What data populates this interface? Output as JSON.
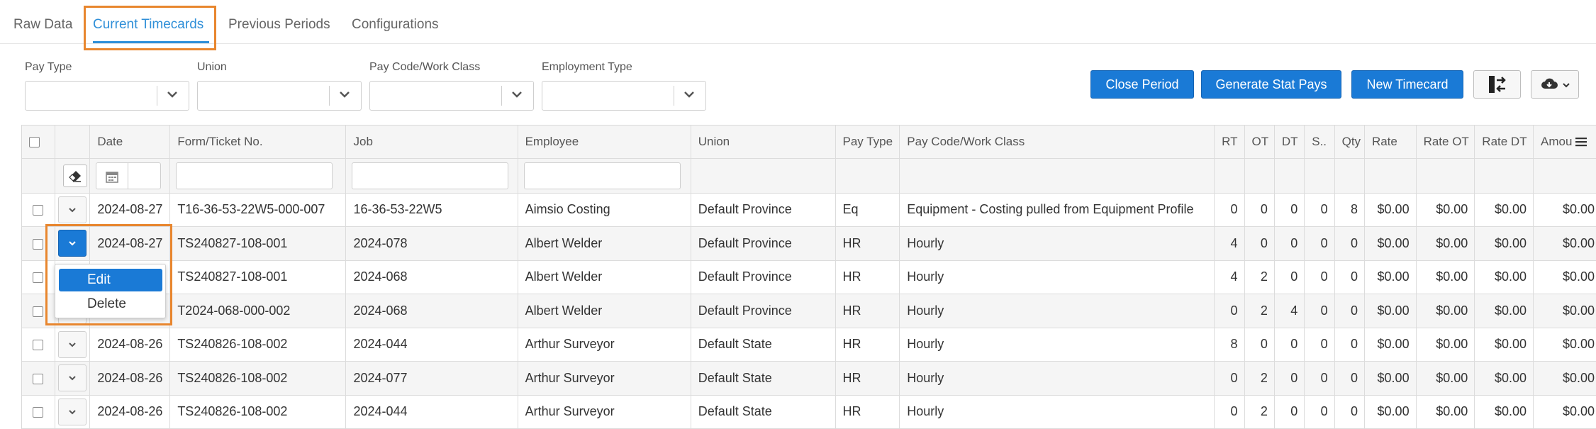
{
  "tabs": [
    {
      "label": "Raw Data"
    },
    {
      "label": "Current Timecards"
    },
    {
      "label": "Previous Periods"
    },
    {
      "label": "Configurations"
    }
  ],
  "filters": [
    {
      "label": "Pay Type",
      "value": ""
    },
    {
      "label": "Union",
      "value": ""
    },
    {
      "label": "Pay Code/Work Class",
      "value": ""
    },
    {
      "label": "Employment Type",
      "value": ""
    }
  ],
  "toolbar": {
    "close_period": "Close Period",
    "generate_stat_pays": "Generate Stat Pays",
    "new_timecard": "New Timecard"
  },
  "grid": {
    "columns": [
      "Date",
      "Form/Ticket No.",
      "Job",
      "Employee",
      "Union",
      "Pay Type",
      "Pay Code/Work Class",
      "RT",
      "OT",
      "DT",
      "S..",
      "Qty",
      "Rate",
      "Rate OT",
      "Rate DT",
      "Amou"
    ],
    "rows": [
      [
        "2024-08-27",
        "T16-36-53-22W5-000-007",
        "16-36-53-22W5",
        "Aimsio Costing",
        "Default Province",
        "Eq",
        "Equipment - Costing pulled from Equipment Profile",
        "0",
        "0",
        "0",
        "0",
        "8",
        "$0.00",
        "$0.00",
        "$0.00",
        "$0.00"
      ],
      [
        "2024-08-27",
        "TS240827-108-001",
        "2024-078",
        "Albert Welder",
        "Default Province",
        "HR",
        "Hourly",
        "4",
        "0",
        "0",
        "0",
        "0",
        "$0.00",
        "$0.00",
        "$0.00",
        "$0.00"
      ],
      [
        "",
        "TS240827-108-001",
        "2024-068",
        "Albert Welder",
        "Default Province",
        "HR",
        "Hourly",
        "4",
        "2",
        "0",
        "0",
        "0",
        "$0.00",
        "$0.00",
        "$0.00",
        "$0.00"
      ],
      [
        "",
        "T2024-068-000-002",
        "2024-068",
        "Albert Welder",
        "Default Province",
        "HR",
        "Hourly",
        "0",
        "2",
        "4",
        "0",
        "0",
        "$0.00",
        "$0.00",
        "$0.00",
        "$0.00"
      ],
      [
        "2024-08-26",
        "TS240826-108-002",
        "2024-044",
        "Arthur Surveyor",
        "Default State",
        "HR",
        "Hourly",
        "8",
        "0",
        "0",
        "0",
        "0",
        "$0.00",
        "$0.00",
        "$0.00",
        "$0.00"
      ],
      [
        "2024-08-26",
        "TS240826-108-002",
        "2024-077",
        "Arthur Surveyor",
        "Default State",
        "HR",
        "Hourly",
        "0",
        "2",
        "0",
        "0",
        "0",
        "$0.00",
        "$0.00",
        "$0.00",
        "$0.00"
      ],
      [
        "2024-08-26",
        "TS240826-108-002",
        "2024-044",
        "Arthur Surveyor",
        "Default State",
        "HR",
        "Hourly",
        "0",
        "2",
        "0",
        "0",
        "0",
        "$0.00",
        "$0.00",
        "$0.00",
        "$0.00"
      ]
    ]
  },
  "row_menu": {
    "items": [
      {
        "label": "Edit"
      },
      {
        "label": "Delete"
      }
    ]
  },
  "icons": {
    "accent": "#1a7ad6",
    "highlight": "#e8862e"
  }
}
